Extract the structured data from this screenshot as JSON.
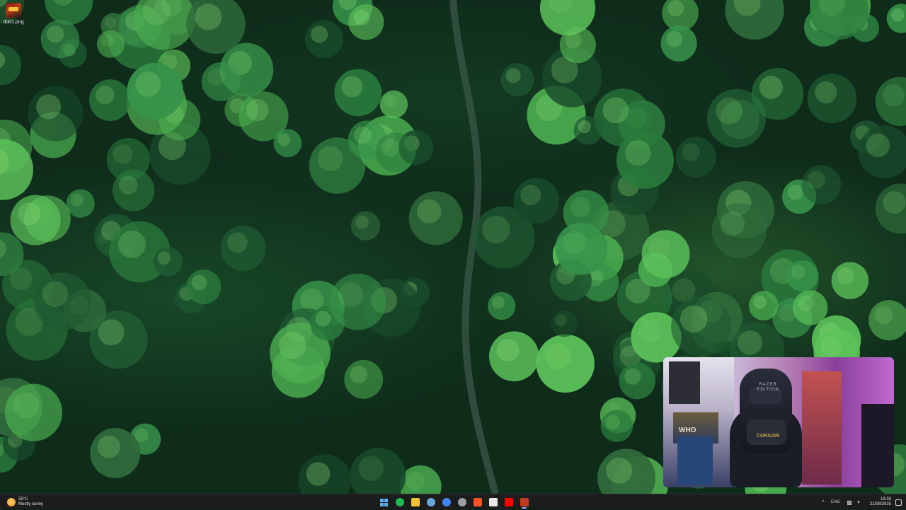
{
  "desktop": {
    "icons": [
      {
        "label": "ddd1.png",
        "icon": "image-file-icon"
      }
    ]
  },
  "webcam_overlay": {
    "chair_brand": "RAZER EDITION",
    "chair_logo": "CORSAIR",
    "poster_text": "WHO"
  },
  "taskbar": {
    "weather": {
      "temperature": "25°C",
      "condition": "Mostly sunny",
      "icon": "sun-icon"
    },
    "apps": [
      {
        "name": "start",
        "icon": "windows-start-icon",
        "color": "#5ab0f5",
        "active": false
      },
      {
        "name": "spotify",
        "icon": "spotify-icon",
        "color": "#1db954",
        "active": false
      },
      {
        "name": "file-explorer",
        "icon": "folder-icon",
        "color": "#f3c23a",
        "active": false
      },
      {
        "name": "steam",
        "icon": "steam-icon",
        "color": "#6aa7d8",
        "active": false
      },
      {
        "name": "chrome",
        "icon": "chrome-icon",
        "color": "#4285f4",
        "active": false
      },
      {
        "name": "app-gray",
        "icon": "app-icon",
        "color": "#9aa0a6",
        "active": false
      },
      {
        "name": "brave",
        "icon": "brave-icon",
        "color": "#fb542b",
        "active": false
      },
      {
        "name": "store",
        "icon": "store-icon",
        "color": "#e8e8e8",
        "active": false
      },
      {
        "name": "youtube",
        "icon": "youtube-icon",
        "color": "#ff0000",
        "active": false
      },
      {
        "name": "image-viewer",
        "icon": "image-viewer-icon",
        "color": "#c23b1a",
        "active": true
      }
    ],
    "tray": {
      "language": "ENG",
      "time": "19:33",
      "date": "21/08/2025",
      "icons": [
        "chevron-up-icon",
        "monitor-icon",
        "speaker-icon",
        "notification-icon"
      ]
    }
  }
}
